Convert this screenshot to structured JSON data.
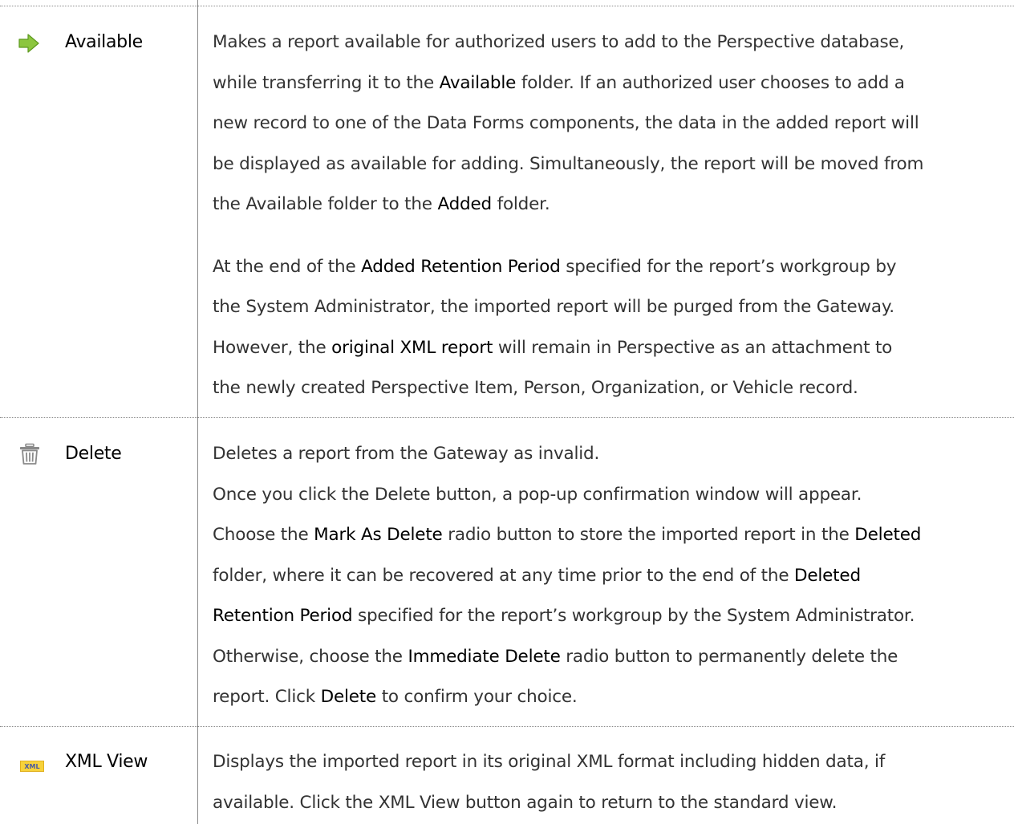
{
  "rows": [
    {
      "term": "Available",
      "icon": "right-arrow-icon",
      "paragraphs": [
        [
          [
            "Makes a report available for authorized users to add to the Perspective database,"
          ],
          [
            "while transferring it to the ",
            {
              "b": "Available"
            },
            " folder. If an authorized user chooses to add a"
          ],
          [
            "new record to one of the Data Forms components, the data in the added report will"
          ],
          [
            "be displayed as available for adding. Simultaneously, the report will be moved from"
          ],
          [
            "the Available folder to the ",
            {
              "b": "Added"
            },
            " folder."
          ]
        ],
        [
          [
            "At the end of the ",
            {
              "b": "Added Retention Period"
            },
            " specified for the report’s workgroup by"
          ],
          [
            "the System Administrator, the imported report will be purged from the Gateway."
          ],
          [
            "However, the ",
            {
              "b": "original XML report"
            },
            " will remain in Perspective as an attachment to"
          ],
          [
            "the newly created Perspective Item, Person, Organization, or Vehicle record."
          ]
        ]
      ]
    },
    {
      "term": "Delete",
      "icon": "trash-icon",
      "paragraphs": [
        [
          [
            "Deletes a report from the Gateway as invalid."
          ],
          [
            "Once you click the Delete button, a pop-up confirmation window will appear."
          ],
          [
            "Choose the ",
            {
              "b": "Mark As Delete"
            },
            " radio button to store the imported report in the ",
            {
              "b": "Deleted"
            }
          ],
          [
            "folder, where it can be recovered at any time prior to the end of the ",
            {
              "b": "Deleted"
            }
          ],
          [
            {
              "b": "Retention Period"
            },
            " specified for the report’s workgroup by the System Administrator."
          ],
          [
            "Otherwise, choose the ",
            {
              "b": "Immediate Delete"
            },
            " radio button to permanently delete the"
          ],
          [
            "report. Click ",
            {
              "b": "Delete"
            },
            " to confirm your choice."
          ]
        ]
      ]
    },
    {
      "term": "XML View",
      "icon": "xml-icon",
      "paragraphs": [
        [
          [
            "Displays the imported report in its original XML format including hidden data, if"
          ],
          [
            "available. Click the XML View button again to return to the standard view."
          ]
        ]
      ]
    }
  ],
  "icons": {
    "xml_label": "XML"
  },
  "colors": {
    "arrow_fill": "#8cc63f",
    "arrow_stroke": "#5e9a1f",
    "trash": "#8a8a8a",
    "xml_bg": "#f7d23a",
    "xml_text": "#4a5aa0",
    "rule": "#8a8a8a"
  }
}
